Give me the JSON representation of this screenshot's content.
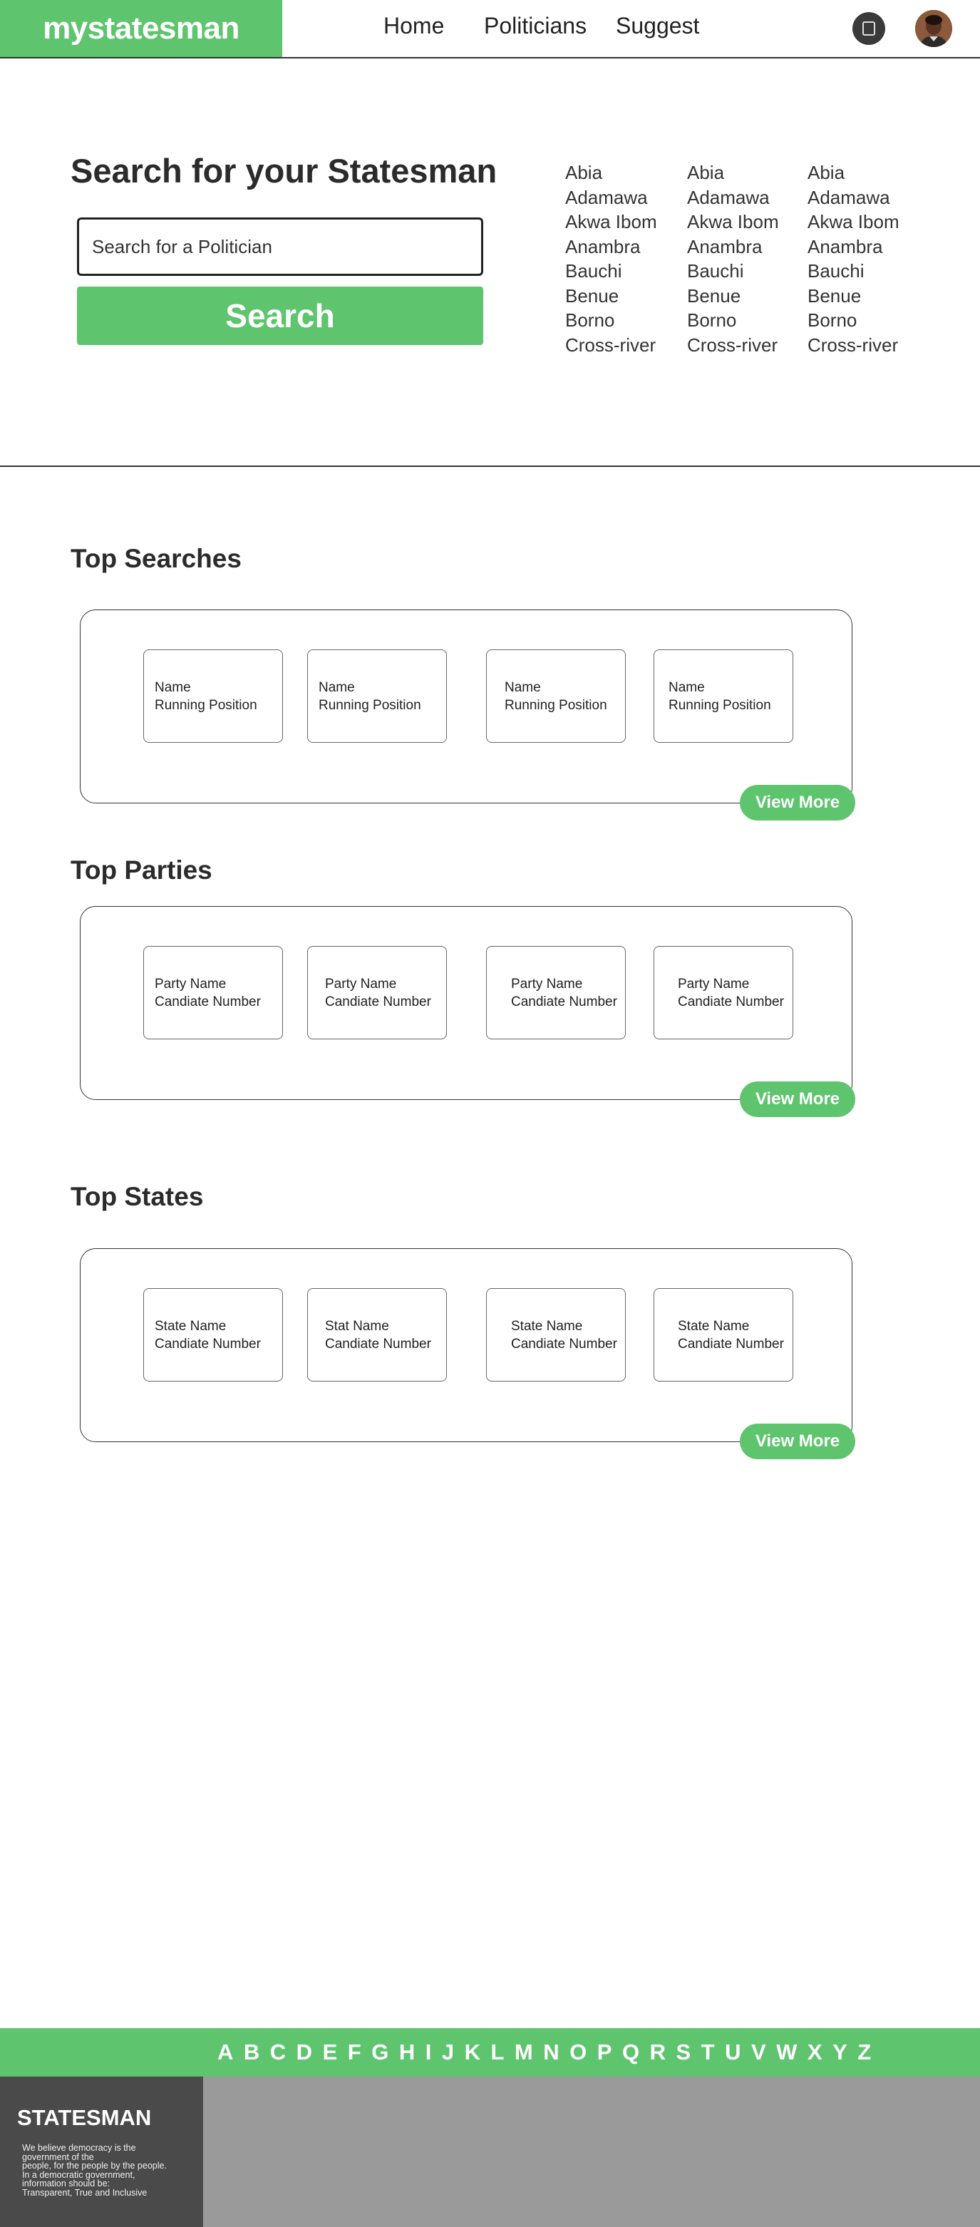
{
  "header": {
    "logo": "mystatesman",
    "nav": [
      "Home",
      "Politicians",
      "Suggest"
    ],
    "icons": [
      "square-icon",
      "profile-avatar"
    ]
  },
  "hero": {
    "title": "Search for your Statesman",
    "search_placeholder": "Search for a Politician",
    "search_button": "Search",
    "states": [
      [
        "Abia",
        "Adamawa",
        "Akwa  Ibom",
        "Anambra",
        "Bauchi",
        "Benue",
        "Borno",
        "Cross-river"
      ],
      [
        "Abia",
        "Adamawa",
        "Akwa  Ibom",
        "Anambra",
        "Bauchi",
        "Benue",
        "Borno",
        "Cross-river"
      ],
      [
        "Abia",
        "Adamawa",
        "Akwa  Ibom",
        "Anambra",
        "Bauchi",
        "Benue",
        "Borno",
        "Cross-river"
      ]
    ]
  },
  "sections": {
    "top_searches": {
      "title": "Top Searches",
      "cards": [
        {
          "line1": "Name",
          "line2": "Running Position"
        },
        {
          "line1": "Name",
          "line2": "Running Position"
        },
        {
          "line1": "Name",
          "line2": "Running Position"
        },
        {
          "line1": "Name",
          "line2": "Running Position"
        }
      ],
      "view_more": "View More"
    },
    "top_parties": {
      "title": "Top Parties",
      "cards": [
        {
          "line1": "Party Name",
          "line2": "Candiate Number"
        },
        {
          "line1": "Party Name",
          "line2": "Candiate Number"
        },
        {
          "line1": "Party Name",
          "line2": "Candiate Number"
        },
        {
          "line1": "Party Name",
          "line2": "Candiate Number"
        }
      ],
      "view_more": "View More"
    },
    "top_states": {
      "title": "Top States",
      "cards": [
        {
          "line1": "State Name",
          "line2": "Candiate Number"
        },
        {
          "line1": "Stat Name",
          "line2": "Candiate Number"
        },
        {
          "line1": "State Name",
          "line2": "Candiate Number"
        },
        {
          "line1": "State Name",
          "line2": "Candiate Number"
        }
      ],
      "view_more": "View More"
    }
  },
  "footer": {
    "alphabet": [
      "A",
      "B",
      "C",
      "D",
      "E",
      "F",
      "G",
      "H",
      "I",
      "J",
      "K",
      "L",
      "M",
      "N",
      "O",
      "P",
      "Q",
      "R",
      "S",
      "T",
      "U",
      "V",
      "W",
      "X",
      "Y",
      "Z"
    ],
    "brand": "STATESMAN",
    "tagline": [
      "We believe democracy is the",
      "government of the",
      "people, for the people by the people.",
      "In a democratic government,",
      "information should be:",
      "Transparent, True and Inclusive"
    ]
  },
  "colors": {
    "accent": "#5ec46e",
    "footer_dark": "#4a4a4a",
    "footer_gray": "#9a9a9a"
  }
}
